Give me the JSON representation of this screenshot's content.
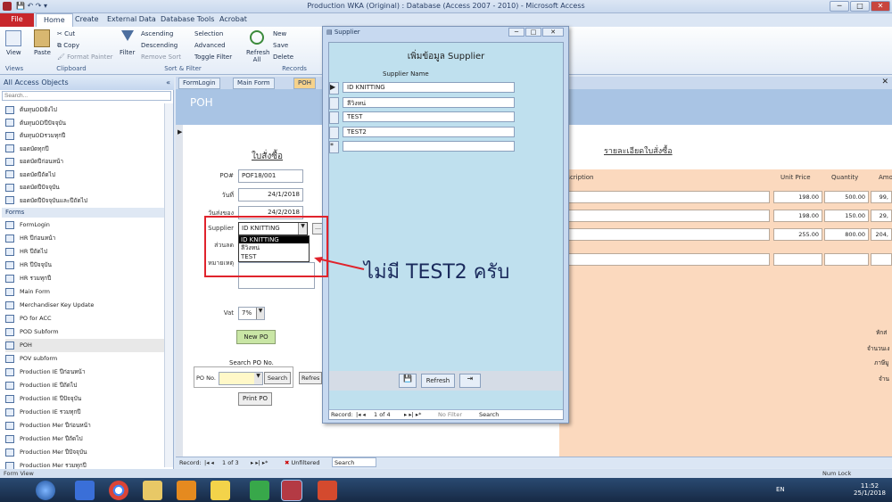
{
  "window": {
    "title": "Production WKA (Original) : Database (Access 2007 - 2010) - Microsoft Access"
  },
  "ribbon_tabs": [
    "File",
    "Home",
    "Create",
    "External Data",
    "Database Tools",
    "Acrobat"
  ],
  "ribbon": {
    "views": "View",
    "views_group": "Views",
    "paste": "Paste",
    "cut": "Cut",
    "copy": "Copy",
    "format_painter": "Format Painter",
    "clipboard_group": "Clipboard",
    "filter": "Filter",
    "ascending": "Ascending",
    "descending": "Descending",
    "remove_sort": "Remove Sort",
    "selection": "Selection",
    "advanced": "Advanced",
    "toggle_filter": "Toggle Filter",
    "sort_group": "Sort & Filter",
    "refresh": "Refresh All",
    "new": "New",
    "save": "Save",
    "delete": "Delete",
    "records_group": "Records"
  },
  "nav": {
    "title": "All Access Objects",
    "search_placeholder": "Search...",
    "top_items": [
      "ต้นทุนODยิงไป",
      "ต้นทุนODปีปัจจุบัน",
      "ต้นทุนODรวมทุกปี",
      "ยอดบัดทุกปี",
      "ยอดบัดปีก่อนหน้า",
      "ยอดบัดปีถัดไป",
      "ยอดบัดปีปัจจุบัน",
      "ยอดบัดปีปัจจุบันและปีถัดไป"
    ],
    "forms_section": "Forms",
    "forms": [
      "FormLogin",
      "HR ปีก่อนหน้า",
      "HR ปีถัดไป",
      "HR ปีปัจจุบัน",
      "HR รวมทุกปี",
      "Main Form",
      "Merchandiser Key Update",
      "PO for ACC",
      "POD Subform",
      "POH",
      "POV subform",
      "Production IE ปีก่อนหน้า",
      "Production IE ปีถัดไป",
      "Production IE ปีปัจจุบัน",
      "Production IE รวมทุกปี",
      "Production Mer ปีก่อนหน้า",
      "Production Mer ปีถัดไป",
      "Production Mer ปีปัจจุบัน",
      "Production Mer รวมทุกปี"
    ]
  },
  "doc_tabs": [
    "FormLogin",
    "Main Form",
    "POH"
  ],
  "poh": {
    "header": "POH",
    "heading": "ใบสั่งซื้อ",
    "po_label": "PO#",
    "po_value": "POF18/001",
    "date_label": "วันที่",
    "date_value": "24/1/2018",
    "deliver_label": "วันส่งของ",
    "deliver_value": "24/2/2018",
    "supplier_label": "Supplier",
    "supplier_value": "ID KNITTING",
    "dropdown_options": [
      "ID KNITTING",
      "ลีวิงหน่",
      "TEST"
    ],
    "discount_label": "ส่วนลด",
    "note_label": "หมายเหตุ",
    "vat_label": "Vat",
    "vat_value": "7%",
    "new_po": "New PO",
    "search_title": "Search PO No.",
    "search_label": "PO No.",
    "search_btn": "Search",
    "refresh_btn": "Refres",
    "print_btn": "Print PO"
  },
  "detail": {
    "title": "รายละเอียดใบสั่งซื้อ",
    "columns": [
      "escription",
      "Unit Price",
      "Quantity",
      "Amo"
    ],
    "rows": [
      [
        "198.00",
        "500.00",
        "99,"
      ],
      [
        "198.00",
        "150.00",
        "29,"
      ],
      [
        "255.00",
        "800.00",
        "204,"
      ]
    ],
    "side_labels": [
      "หักส่",
      "จำนวนเง",
      "ภาษีมู",
      "จำน"
    ]
  },
  "supplier_popup": {
    "title": "Supplier",
    "heading": "เพิ่มข้อมูล Supplier",
    "col": "Supplier Name",
    "rows": [
      "ID KNITTING",
      "ลีวิงหน่",
      "TEST",
      "TEST2"
    ],
    "refresh": "Refresh",
    "record_label": "Record:",
    "record_pos": "1 of 4",
    "no_filter": "No Filter",
    "search": "Search"
  },
  "status": {
    "record_label": "Record:",
    "record_pos": "1 of 3",
    "filter": "Unfiltered",
    "search": "Search",
    "form_view": "Form View",
    "num_lock": "Num Lock"
  },
  "annotation": "ไม่มี TEST2 ครับ",
  "clock": {
    "time": "11:52",
    "date": "25/1/2018",
    "lang": "EN"
  }
}
